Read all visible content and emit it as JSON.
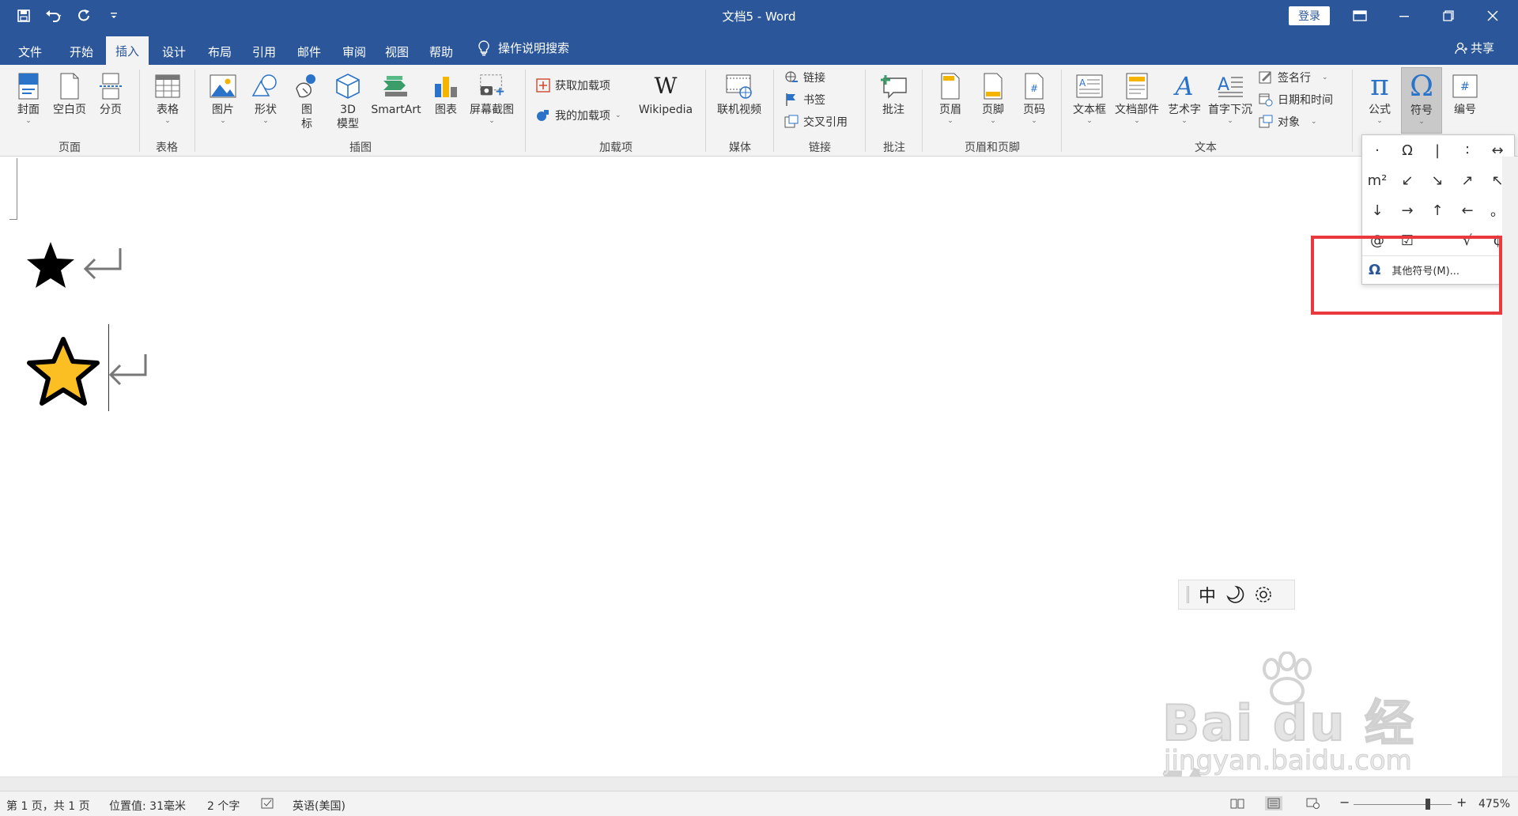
{
  "window": {
    "title": "文档5 - Word",
    "login": "登录"
  },
  "tabs": [
    {
      "label": "文件",
      "active": false
    },
    {
      "label": "开始",
      "active": false
    },
    {
      "label": "插入",
      "active": true
    },
    {
      "label": "设计",
      "active": false
    },
    {
      "label": "布局",
      "active": false
    },
    {
      "label": "引用",
      "active": false
    },
    {
      "label": "邮件",
      "active": false
    },
    {
      "label": "审阅",
      "active": false
    },
    {
      "label": "视图",
      "active": false
    },
    {
      "label": "帮助",
      "active": false
    }
  ],
  "tell_me": "操作说明搜索",
  "share": "共享",
  "ribbon": {
    "pages": {
      "cover": "封面",
      "blank": "空白页",
      "break": "分页",
      "group": "页面"
    },
    "tables": {
      "table": "表格",
      "group": "表格"
    },
    "illustrations": {
      "pictures": "图片",
      "shapes": "形状",
      "icons_1": "图",
      "icons_2": "标",
      "model_1": "3D",
      "model_2": "模型",
      "smartart": "SmartArt",
      "chart": "图表",
      "screenshot": "屏幕截图",
      "group": "插图"
    },
    "addins": {
      "get": "获取加载项",
      "my": "我的加载项",
      "wikipedia": "Wikipedia",
      "group": "加载项"
    },
    "media": {
      "video": "联机视频",
      "group": "媒体"
    },
    "links": {
      "link": "链接",
      "bookmark": "书签",
      "crossref": "交叉引用",
      "group": "链接"
    },
    "comments": {
      "comment": "批注",
      "group": "批注"
    },
    "header_footer": {
      "header": "页眉",
      "footer": "页脚",
      "page_number": "页码",
      "group": "页眉和页脚"
    },
    "text": {
      "textbox": "文本框",
      "quickparts": "文档部件",
      "wordart": "艺术字",
      "dropcap": "首字下沉",
      "signature": "签名行",
      "datetime": "日期和时间",
      "object": "对象",
      "group": "文本"
    },
    "symbols": {
      "equation": "公式",
      "symbol": "符号",
      "numbering": "编号"
    }
  },
  "symbol_menu": {
    "symbols": [
      "·",
      "Ω",
      "|",
      "∶",
      "↔",
      "m²",
      "↙",
      "↘",
      "↗",
      "↖",
      "↓",
      "→",
      "↑",
      "←",
      "。",
      "@",
      "☑",
      "",
      "√",
      "¢"
    ],
    "more": "其他符号(M)..."
  },
  "ime": {
    "mode": "中"
  },
  "watermark": {
    "main": "Bai du 经验",
    "sub": "jingyan.baidu.com"
  },
  "status": {
    "page": "第 1 页，共 1 页",
    "position": "位置值: 31毫米",
    "words": "2 个字",
    "language": "英语(美国)",
    "zoom": "475%",
    "zoom_level": 0.76
  },
  "colors": {
    "brand": "#2b579a",
    "star_fill": "#fbbf24",
    "highlight": "#e8393f"
  }
}
